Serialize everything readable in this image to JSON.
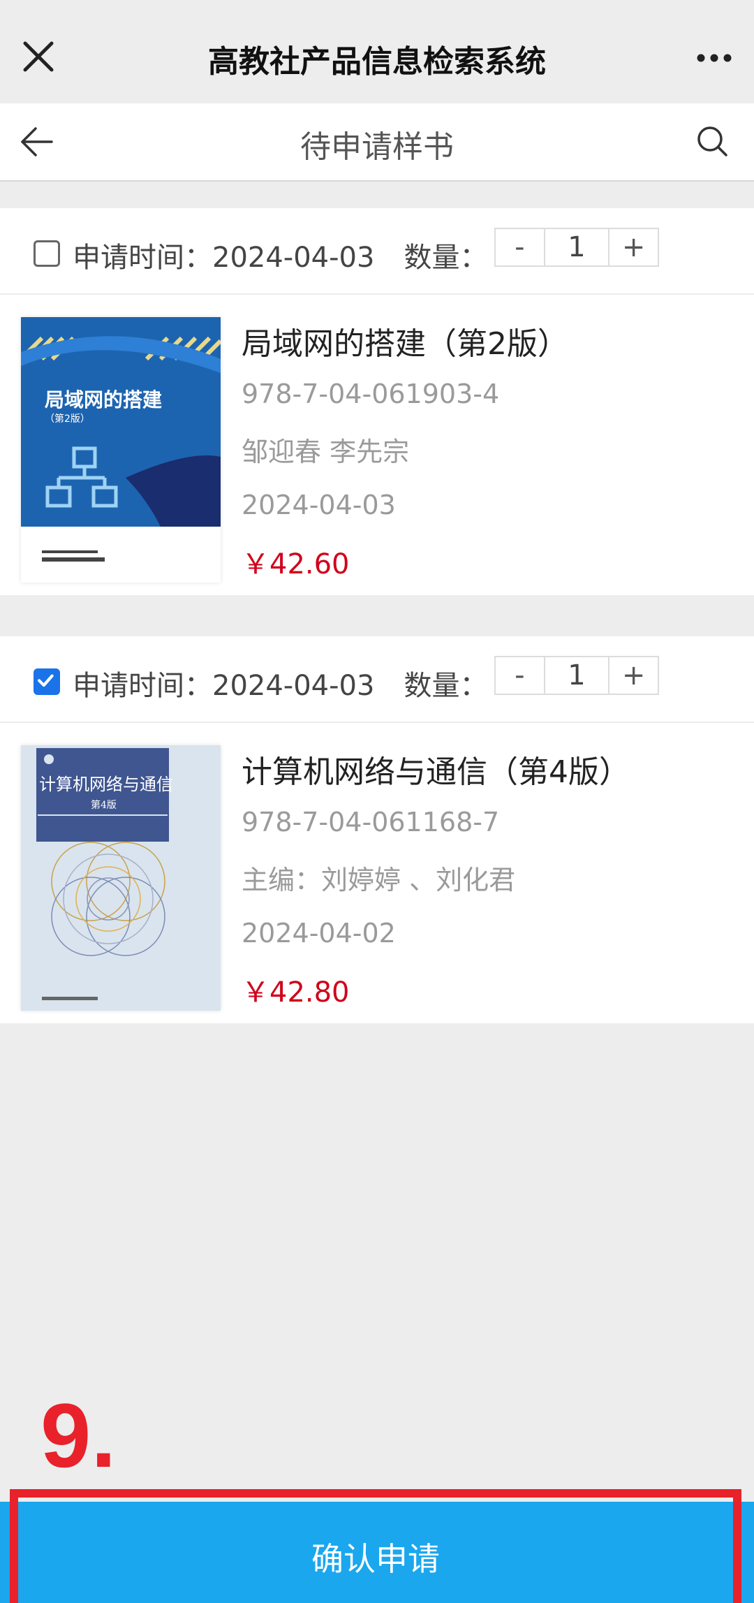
{
  "app": {
    "title": "高教社产品信息检索系统"
  },
  "nav": {
    "title": "待申请样书"
  },
  "items": [
    {
      "checked": false,
      "apply_time": "申请时间：2024-04-03",
      "qty_label": "数量：",
      "qty_minus": "-",
      "qty": "1",
      "qty_plus": "+",
      "name": "局域网的搭建（第2版）",
      "isbn": "978-7-04-061903-4",
      "authors": "邹迎春 李先宗",
      "date": "2024-04-03",
      "price": "￥42.60",
      "cover_title": "局域网的搭建",
      "cover_edition": "（第2版）"
    },
    {
      "checked": true,
      "apply_time": "申请时间：2024-04-03",
      "qty_label": "数量：",
      "qty_minus": "-",
      "qty": "1",
      "qty_plus": "+",
      "name": "计算机网络与通信（第4版）",
      "isbn": "978-7-04-061168-7",
      "authors": "主编：刘婷婷 、刘化君",
      "date": "2024-04-02",
      "price": "￥42.80",
      "cover_title": "计算机网络与通信",
      "cover_edition": "第4版"
    }
  ],
  "annotation": {
    "step": "9."
  },
  "footer": {
    "confirm_label": "确认申请"
  },
  "colors": {
    "accent": "#1aa7ee",
    "price": "#d0021b",
    "highlight": "#e8212a",
    "checkbox": "#1a73e8"
  }
}
